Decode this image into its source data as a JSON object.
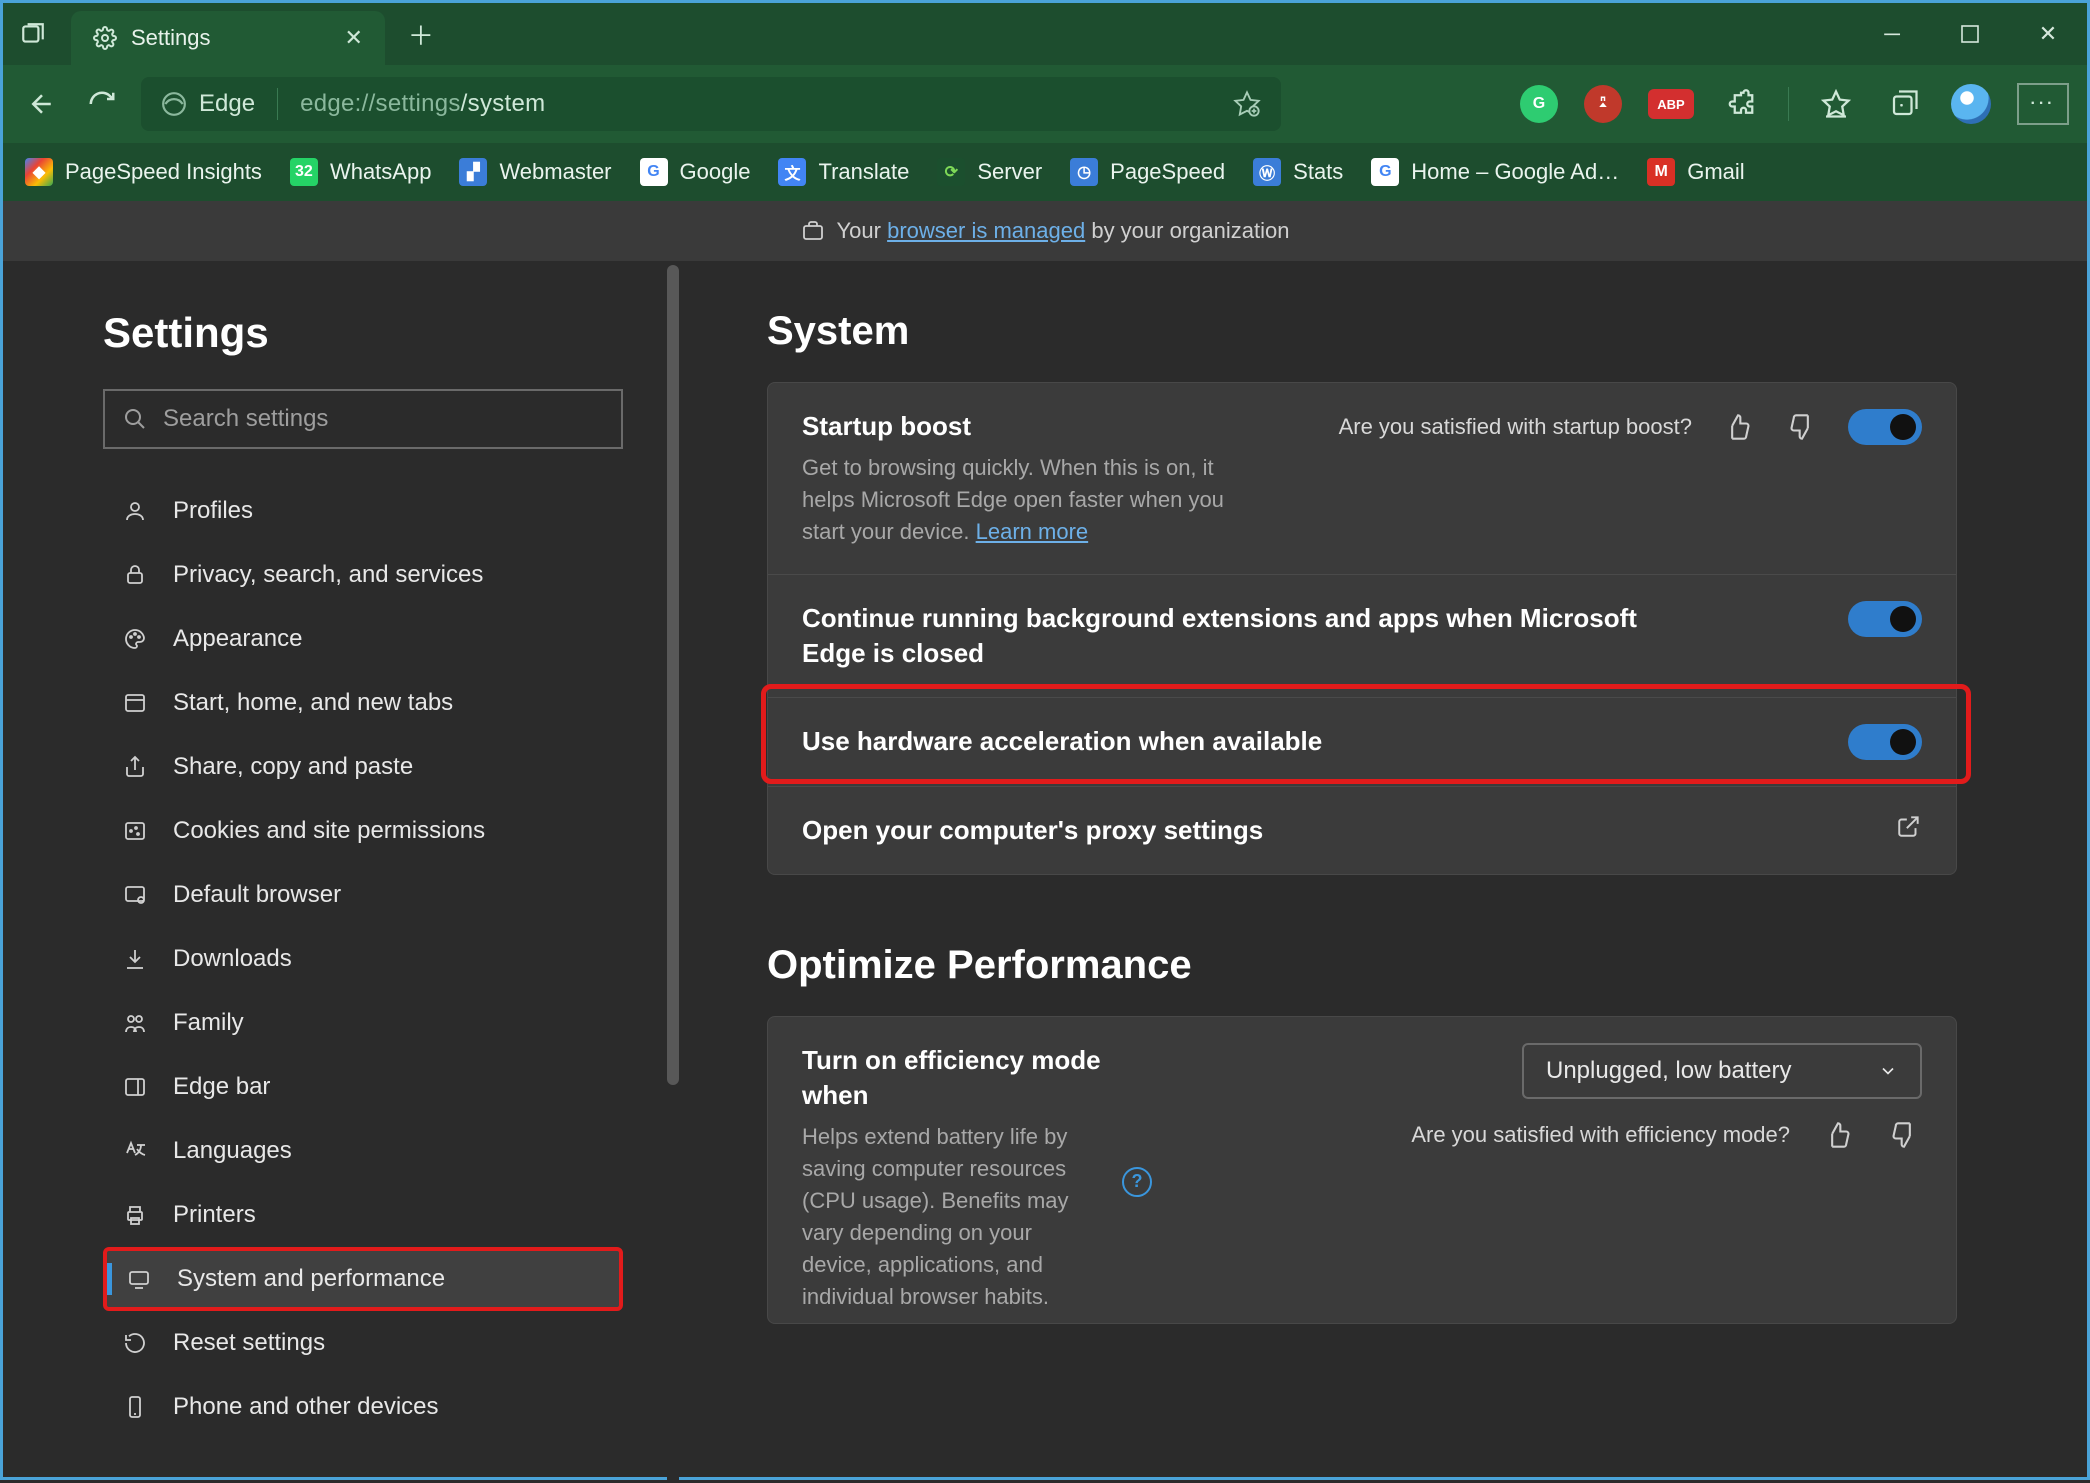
{
  "titlebar": {
    "tab_label": "Settings"
  },
  "addr": {
    "browser_label": "Edge",
    "url_prefix": "edge://settings",
    "url_suffix": "/system"
  },
  "bookmarks": [
    {
      "label": "PageSpeed Insights"
    },
    {
      "label": "WhatsApp"
    },
    {
      "label": "Webmaster"
    },
    {
      "label": "Google"
    },
    {
      "label": "Translate"
    },
    {
      "label": "Server"
    },
    {
      "label": "PageSpeed"
    },
    {
      "label": "Stats"
    },
    {
      "label": "Home – Google Ad…"
    },
    {
      "label": "Gmail"
    }
  ],
  "managed": {
    "prefix": "Your ",
    "link": "browser is managed",
    "suffix": " by your organization"
  },
  "sidebar": {
    "heading": "Settings",
    "search_placeholder": "Search settings",
    "items": [
      {
        "label": "Profiles"
      },
      {
        "label": "Privacy, search, and services"
      },
      {
        "label": "Appearance"
      },
      {
        "label": "Start, home, and new tabs"
      },
      {
        "label": "Share, copy and paste"
      },
      {
        "label": "Cookies and site permissions"
      },
      {
        "label": "Default browser"
      },
      {
        "label": "Downloads"
      },
      {
        "label": "Family"
      },
      {
        "label": "Edge bar"
      },
      {
        "label": "Languages"
      },
      {
        "label": "Printers"
      },
      {
        "label": "System and performance"
      },
      {
        "label": "Reset settings"
      },
      {
        "label": "Phone and other devices"
      }
    ]
  },
  "system": {
    "heading": "System",
    "startup": {
      "title": "Startup boost",
      "desc_pre": "Get to browsing quickly. When this is on, it helps Microsoft Edge open faster when you start your device. ",
      "learn": "Learn more",
      "feedback_q": "Are you satisfied with startup boost?"
    },
    "bg": {
      "title": "Continue running background extensions and apps when Microsoft Edge is closed"
    },
    "hw": {
      "title": "Use hardware acceleration when available"
    },
    "proxy": {
      "title": "Open your computer's proxy settings"
    }
  },
  "perf": {
    "heading": "Optimize Performance",
    "eff": {
      "title": "Turn on efficiency mode when",
      "desc": "Helps extend battery life by saving computer resources (CPU usage). Benefits may vary depending on your device, applications, and individual browser habits.",
      "dropdown": "Unplugged, low battery",
      "feedback_q": "Are you satisfied with efficiency mode?"
    }
  }
}
